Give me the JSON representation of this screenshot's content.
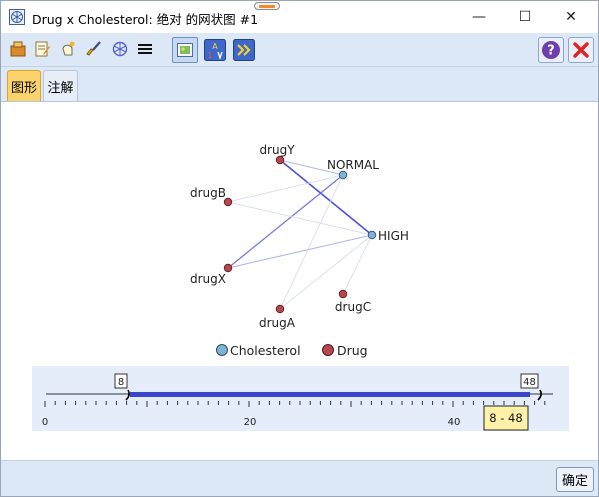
{
  "window": {
    "title": "Drug x Cholesterol: 绝对 的网状图 #1",
    "minimize_glyph": "—",
    "maximize_glyph": "☐",
    "close_glyph": "✕"
  },
  "toolbar": {
    "left_icons": [
      "export-icon",
      "edit-icon",
      "interaction-icon",
      "brush-icon",
      "web-icon",
      "menu-lines-icon"
    ],
    "mode_icons": [
      "graph-view-icon",
      "sort-az-icon",
      "fast-forward-icon"
    ],
    "help_glyph": "?",
    "close_glyph": "✕"
  },
  "tabs": [
    {
      "label": "图形",
      "active": true
    },
    {
      "label": "注解",
      "active": false
    }
  ],
  "web": {
    "nodes": [
      {
        "name": "drugY",
        "group": "Drug"
      },
      {
        "name": "NORMAL",
        "group": "Cholesterol"
      },
      {
        "name": "drugB",
        "group": "Drug"
      },
      {
        "name": "HIGH",
        "group": "Cholesterol"
      },
      {
        "name": "drugX",
        "group": "Drug"
      },
      {
        "name": "drugA",
        "group": "Drug"
      },
      {
        "name": "drugC",
        "group": "Drug"
      }
    ],
    "links": [
      {
        "source": "drugY",
        "target": "HIGH",
        "strength": "strong"
      },
      {
        "source": "drugX",
        "target": "NORMAL",
        "strength": "medium"
      },
      {
        "source": "drugY",
        "target": "NORMAL",
        "strength": "weak"
      },
      {
        "source": "drugX",
        "target": "HIGH",
        "strength": "weak"
      },
      {
        "source": "drugB",
        "target": "HIGH",
        "strength": "faint"
      },
      {
        "source": "drugA",
        "target": "NORMAL",
        "strength": "faint"
      },
      {
        "source": "drugA",
        "target": "HIGH",
        "strength": "faint"
      },
      {
        "source": "drugC",
        "target": "HIGH",
        "strength": "faint"
      },
      {
        "source": "drugB",
        "target": "NORMAL",
        "strength": "faint"
      }
    ],
    "legend": [
      {
        "label": "Cholesterol",
        "color": "#7fb3d5"
      },
      {
        "label": "Drug",
        "color": "#b5474f"
      }
    ]
  },
  "slider": {
    "axis_min": 0,
    "axis_max": 55,
    "range_min": 8,
    "range_max": 48,
    "min_box": "8",
    "max_box": "48",
    "tick_labels": [
      "0",
      "20",
      "40"
    ],
    "range_readout": "8 - 48"
  },
  "bottom": {
    "ok_label": "确定"
  },
  "colors": {
    "accent_blue": "#3a45c9",
    "active_tab": "#fbd36b",
    "panel_bg": "#dde8f7"
  }
}
